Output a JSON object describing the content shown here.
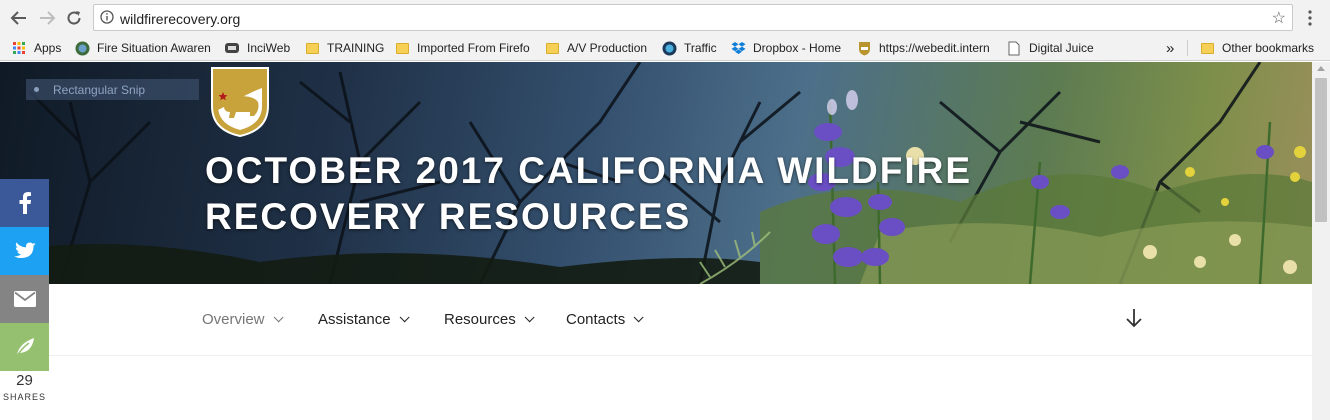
{
  "browser": {
    "url": "wildfirerecovery.org",
    "bookmarks": [
      {
        "label": "Apps",
        "icon": "apps-grid-icon"
      },
      {
        "label": "Fire Situation Awaren",
        "icon": "globe-icon"
      },
      {
        "label": "InciWeb",
        "icon": "inciweb-icon"
      },
      {
        "label": "TRAINING",
        "icon": "folder-icon"
      },
      {
        "label": "Imported From Firefo",
        "icon": "folder-icon"
      },
      {
        "label": "A/V Production",
        "icon": "folder-icon"
      },
      {
        "label": "Traffic",
        "icon": "traffic-icon"
      },
      {
        "label": "Dropbox - Home",
        "icon": "dropbox-icon"
      },
      {
        "label": "https://webedit.intern",
        "icon": "shield-icon"
      },
      {
        "label": "Digital Juice",
        "icon": "page-icon"
      }
    ],
    "overflow_label": "»",
    "other_bookmarks": "Other bookmarks"
  },
  "page": {
    "snip_label": "Rectangular Snip",
    "title_line1": "OCTOBER 2017 CALIFORNIA WILDFIRE",
    "title_line2": "RECOVERY RESOURCES",
    "nav": [
      {
        "label": "Overview",
        "current": true
      },
      {
        "label": "Assistance",
        "current": false
      },
      {
        "label": "Resources",
        "current": false
      },
      {
        "label": "Contacts",
        "current": false
      }
    ]
  },
  "share": {
    "count": "29",
    "label": "SHARES",
    "buttons": [
      {
        "name": "facebook",
        "color": "#3b5998"
      },
      {
        "name": "twitter",
        "color": "#1da1f2"
      },
      {
        "name": "email",
        "color": "#848484"
      },
      {
        "name": "sharethis",
        "color": "#95c070"
      }
    ]
  },
  "colors": {
    "title": "#ffffff",
    "nav_current": "#767676",
    "nav_text": "#222222",
    "logo_gold": "#c8a23a"
  }
}
